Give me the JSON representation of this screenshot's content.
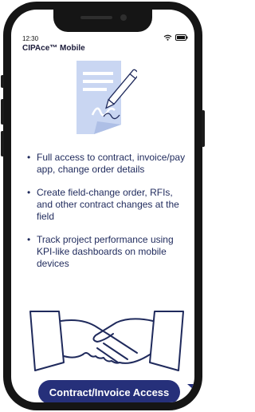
{
  "status_bar": {
    "time": "12:30",
    "wifi_icon": "wifi-icon",
    "battery_icon": "battery-icon"
  },
  "app": {
    "title": "CIPAce™ Mobile"
  },
  "illustration": {
    "icon": "signed-document-icon"
  },
  "features": [
    {
      "bullet": "•",
      "text": "Full access to contract, invoice/pay app, change order details"
    },
    {
      "bullet": "•",
      "text": "Create field-change order, RFIs, and other contract changes at the field"
    },
    {
      "bullet": "•",
      "text": "Track project performance using KPI-like dashboards on mobile devices"
    }
  ],
  "handshake": {
    "icon": "handshake-icon"
  },
  "cta": {
    "label": "Contract/Invoice Access",
    "icon": "send-arrow-icon"
  },
  "colors": {
    "accent": "#26307a",
    "text": "#1f2a5c",
    "illustration": "#c9d6f2"
  }
}
